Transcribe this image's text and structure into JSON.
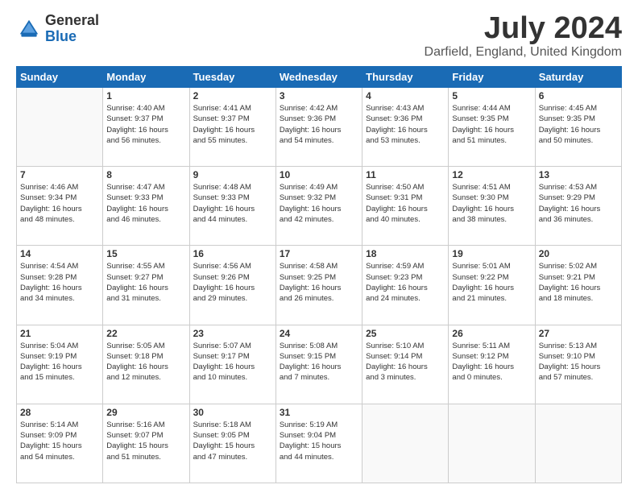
{
  "logo": {
    "general": "General",
    "blue": "Blue"
  },
  "title": "July 2024",
  "location": "Darfield, England, United Kingdom",
  "days_of_week": [
    "Sunday",
    "Monday",
    "Tuesday",
    "Wednesday",
    "Thursday",
    "Friday",
    "Saturday"
  ],
  "weeks": [
    [
      {
        "day": "",
        "info": ""
      },
      {
        "day": "1",
        "info": "Sunrise: 4:40 AM\nSunset: 9:37 PM\nDaylight: 16 hours\nand 56 minutes."
      },
      {
        "day": "2",
        "info": "Sunrise: 4:41 AM\nSunset: 9:37 PM\nDaylight: 16 hours\nand 55 minutes."
      },
      {
        "day": "3",
        "info": "Sunrise: 4:42 AM\nSunset: 9:36 PM\nDaylight: 16 hours\nand 54 minutes."
      },
      {
        "day": "4",
        "info": "Sunrise: 4:43 AM\nSunset: 9:36 PM\nDaylight: 16 hours\nand 53 minutes."
      },
      {
        "day": "5",
        "info": "Sunrise: 4:44 AM\nSunset: 9:35 PM\nDaylight: 16 hours\nand 51 minutes."
      },
      {
        "day": "6",
        "info": "Sunrise: 4:45 AM\nSunset: 9:35 PM\nDaylight: 16 hours\nand 50 minutes."
      }
    ],
    [
      {
        "day": "7",
        "info": "Sunrise: 4:46 AM\nSunset: 9:34 PM\nDaylight: 16 hours\nand 48 minutes."
      },
      {
        "day": "8",
        "info": "Sunrise: 4:47 AM\nSunset: 9:33 PM\nDaylight: 16 hours\nand 46 minutes."
      },
      {
        "day": "9",
        "info": "Sunrise: 4:48 AM\nSunset: 9:33 PM\nDaylight: 16 hours\nand 44 minutes."
      },
      {
        "day": "10",
        "info": "Sunrise: 4:49 AM\nSunset: 9:32 PM\nDaylight: 16 hours\nand 42 minutes."
      },
      {
        "day": "11",
        "info": "Sunrise: 4:50 AM\nSunset: 9:31 PM\nDaylight: 16 hours\nand 40 minutes."
      },
      {
        "day": "12",
        "info": "Sunrise: 4:51 AM\nSunset: 9:30 PM\nDaylight: 16 hours\nand 38 minutes."
      },
      {
        "day": "13",
        "info": "Sunrise: 4:53 AM\nSunset: 9:29 PM\nDaylight: 16 hours\nand 36 minutes."
      }
    ],
    [
      {
        "day": "14",
        "info": "Sunrise: 4:54 AM\nSunset: 9:28 PM\nDaylight: 16 hours\nand 34 minutes."
      },
      {
        "day": "15",
        "info": "Sunrise: 4:55 AM\nSunset: 9:27 PM\nDaylight: 16 hours\nand 31 minutes."
      },
      {
        "day": "16",
        "info": "Sunrise: 4:56 AM\nSunset: 9:26 PM\nDaylight: 16 hours\nand 29 minutes."
      },
      {
        "day": "17",
        "info": "Sunrise: 4:58 AM\nSunset: 9:25 PM\nDaylight: 16 hours\nand 26 minutes."
      },
      {
        "day": "18",
        "info": "Sunrise: 4:59 AM\nSunset: 9:23 PM\nDaylight: 16 hours\nand 24 minutes."
      },
      {
        "day": "19",
        "info": "Sunrise: 5:01 AM\nSunset: 9:22 PM\nDaylight: 16 hours\nand 21 minutes."
      },
      {
        "day": "20",
        "info": "Sunrise: 5:02 AM\nSunset: 9:21 PM\nDaylight: 16 hours\nand 18 minutes."
      }
    ],
    [
      {
        "day": "21",
        "info": "Sunrise: 5:04 AM\nSunset: 9:19 PM\nDaylight: 16 hours\nand 15 minutes."
      },
      {
        "day": "22",
        "info": "Sunrise: 5:05 AM\nSunset: 9:18 PM\nDaylight: 16 hours\nand 12 minutes."
      },
      {
        "day": "23",
        "info": "Sunrise: 5:07 AM\nSunset: 9:17 PM\nDaylight: 16 hours\nand 10 minutes."
      },
      {
        "day": "24",
        "info": "Sunrise: 5:08 AM\nSunset: 9:15 PM\nDaylight: 16 hours\nand 7 minutes."
      },
      {
        "day": "25",
        "info": "Sunrise: 5:10 AM\nSunset: 9:14 PM\nDaylight: 16 hours\nand 3 minutes."
      },
      {
        "day": "26",
        "info": "Sunrise: 5:11 AM\nSunset: 9:12 PM\nDaylight: 16 hours\nand 0 minutes."
      },
      {
        "day": "27",
        "info": "Sunrise: 5:13 AM\nSunset: 9:10 PM\nDaylight: 15 hours\nand 57 minutes."
      }
    ],
    [
      {
        "day": "28",
        "info": "Sunrise: 5:14 AM\nSunset: 9:09 PM\nDaylight: 15 hours\nand 54 minutes."
      },
      {
        "day": "29",
        "info": "Sunrise: 5:16 AM\nSunset: 9:07 PM\nDaylight: 15 hours\nand 51 minutes."
      },
      {
        "day": "30",
        "info": "Sunrise: 5:18 AM\nSunset: 9:05 PM\nDaylight: 15 hours\nand 47 minutes."
      },
      {
        "day": "31",
        "info": "Sunrise: 5:19 AM\nSunset: 9:04 PM\nDaylight: 15 hours\nand 44 minutes."
      },
      {
        "day": "",
        "info": ""
      },
      {
        "day": "",
        "info": ""
      },
      {
        "day": "",
        "info": ""
      }
    ]
  ]
}
